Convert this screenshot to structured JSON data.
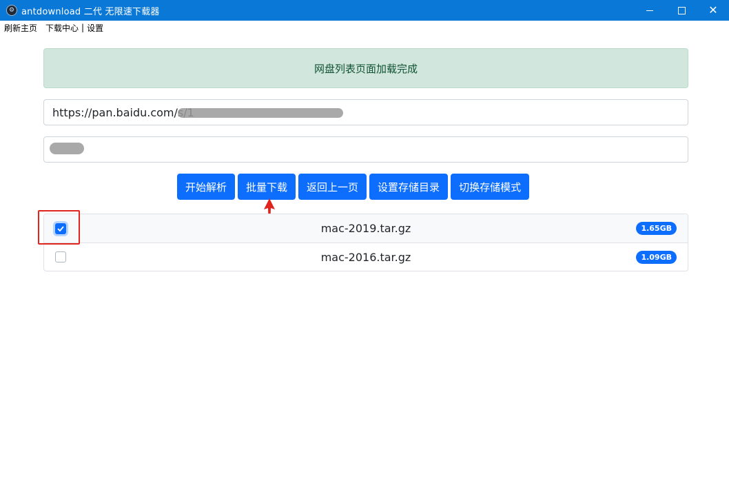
{
  "window": {
    "title": "antdownload 二代 无限速下载器",
    "icon": "app-logo-icon"
  },
  "menu": {
    "items": [
      "刷新主页",
      "下载中心",
      "设置"
    ],
    "separator": "|"
  },
  "alert": {
    "text": "网盘列表页面加载完成",
    "color": "#0f5132",
    "background": "#d1e7dd"
  },
  "url_input": {
    "value": "https://pan.baidu.com/s/1"
  },
  "code_input": {
    "value": ""
  },
  "buttons": {
    "parse": "开始解析",
    "batch_download": "批量下载",
    "back": "返回上一页",
    "set_dir": "设置存储目录",
    "switch_mode": "切换存储模式"
  },
  "files": [
    {
      "name": "mac-2019.tar.gz",
      "size": "1.65GB",
      "checked": true
    },
    {
      "name": "mac-2016.tar.gz",
      "size": "1.09GB",
      "checked": false
    }
  ],
  "colors": {
    "primary": "#0d6efd",
    "titlebar": "#0a78d7",
    "annotation": "#e0231c"
  }
}
